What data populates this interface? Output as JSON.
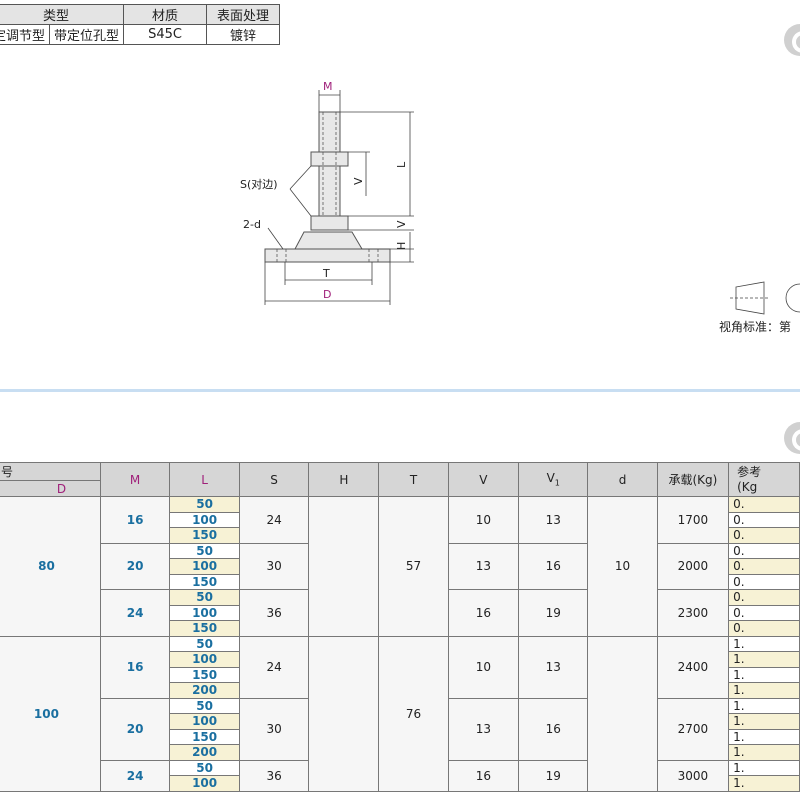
{
  "info_table": {
    "headers": [
      "类型",
      "材质",
      "表面处理"
    ],
    "type_values": [
      "定调节型",
      "带定位孔型"
    ],
    "material": "S45C",
    "surface": "镀锌"
  },
  "drawing_labels": {
    "m": "M",
    "s": "S(对边)",
    "d2": "2-d",
    "l": "L",
    "v1": "V",
    "v1_sub": "1",
    "v": "V",
    "h": "H",
    "t": "T",
    "d": "D"
  },
  "view_standard": "视角标准：第",
  "spec_table": {
    "header_top": "号",
    "header_d": "D",
    "headers": [
      "M",
      "L",
      "S",
      "H",
      "T",
      "V",
      "V",
      "d",
      "承载(Kg)"
    ],
    "v1_sub": "1",
    "header_last": [
      "参考",
      "(Kg"
    ],
    "groups": [
      {
        "d": "80",
        "t": "57",
        "d_hole": "10",
        "subs": [
          {
            "m": "16",
            "l": [
              "50",
              "100",
              "150"
            ],
            "s": "24",
            "v": "10",
            "v1": "13",
            "load": "1700"
          },
          {
            "m": "20",
            "l": [
              "50",
              "100",
              "150"
            ],
            "s": "30",
            "v": "13",
            "v1": "16",
            "load": "2000"
          },
          {
            "m": "24",
            "l": [
              "50",
              "100",
              "150"
            ],
            "s": "36",
            "v": "16",
            "v1": "19",
            "load": "2300"
          }
        ]
      },
      {
        "d": "100",
        "t": "76",
        "d_hole": "",
        "subs": [
          {
            "m": "16",
            "l": [
              "50",
              "100",
              "150",
              "200"
            ],
            "s": "24",
            "v": "10",
            "v1": "13",
            "load": "2400"
          },
          {
            "m": "20",
            "l": [
              "50",
              "100",
              "150",
              "200"
            ],
            "s": "30",
            "v": "13",
            "v1": "16",
            "load": "2700"
          },
          {
            "m": "24",
            "l": [
              "50",
              "100"
            ],
            "s": "36",
            "v": "16",
            "v1": "19",
            "load": "3000"
          }
        ]
      }
    ],
    "ref_values": [
      "0.",
      "0.",
      "0.",
      "0.",
      "0.",
      "0.",
      "0.",
      "0.",
      "0.",
      "1.",
      "1.",
      "1.",
      "1.",
      "1.",
      "1.",
      "1.",
      "1.",
      "1.",
      "1."
    ]
  }
}
